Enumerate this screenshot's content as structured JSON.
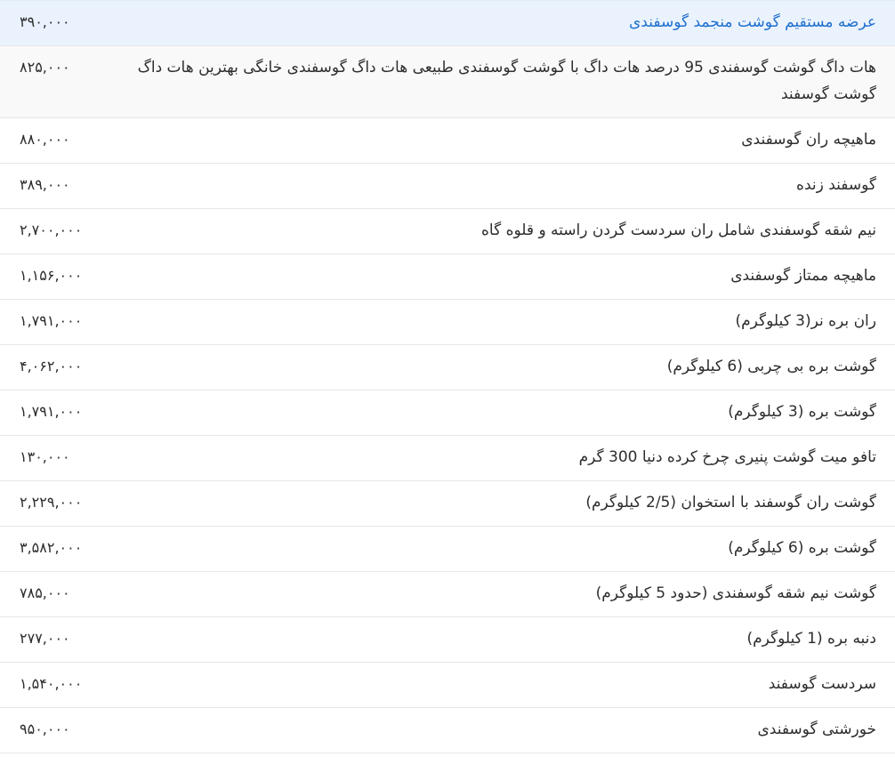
{
  "rows": [
    {
      "name": "عرضه مستقیم گوشت منجمد گوسفندی",
      "price": "۳۹۰,۰۰۰"
    },
    {
      "name": "هات داگ گوشت گوسفندی 95 درصد هات داگ با گوشت گوسفندی طبیعی هات داگ گوسفندی خانگی بهترین هات داگ گوشت گوسفند",
      "price": "۸۲۵,۰۰۰"
    },
    {
      "name": "ماهیچه ران گوسفندی",
      "price": "۸۸۰,۰۰۰"
    },
    {
      "name": "گوسفند زنده",
      "price": "۳۸۹,۰۰۰"
    },
    {
      "name": "نیم شقه گوسفندی شامل ران سردست گردن راسته و قلوه گاه",
      "price": "۲,۷۰۰,۰۰۰"
    },
    {
      "name": "ماهیچه ممتاز گوسفندی",
      "price": "۱,۱۵۶,۰۰۰"
    },
    {
      "name": "ران بره نر(3 کیلوگرم)",
      "price": "۱,۷۹۱,۰۰۰"
    },
    {
      "name": "گوشت بره بی چربی (6 کیلوگرم)",
      "price": "۴,۰۶۲,۰۰۰"
    },
    {
      "name": "گوشت بره (3 کیلوگرم)",
      "price": "۱,۷۹۱,۰۰۰"
    },
    {
      "name": "تافو میت گوشت پنیری چرخ کرده دنیا 300 گرم",
      "price": "۱۳۰,۰۰۰"
    },
    {
      "name": "گوشت ران گوسفند با استخوان (2/5 کیلوگرم)",
      "price": "۲,۲۲۹,۰۰۰"
    },
    {
      "name": "گوشت بره (6 کیلوگرم)",
      "price": "۳,۵۸۲,۰۰۰"
    },
    {
      "name": "گوشت نیم شقه گوسفندی (حدود 5 کیلوگرم)",
      "price": "۷۸۵,۰۰۰"
    },
    {
      "name": "دنبه بره (1 کیلوگرم)",
      "price": "۲۷۷,۰۰۰"
    },
    {
      "name": "سردست گوسفند",
      "price": "۱,۵۴۰,۰۰۰"
    },
    {
      "name": "خورشتی گوسفندی",
      "price": "۹۵۰,۰۰۰"
    }
  ]
}
